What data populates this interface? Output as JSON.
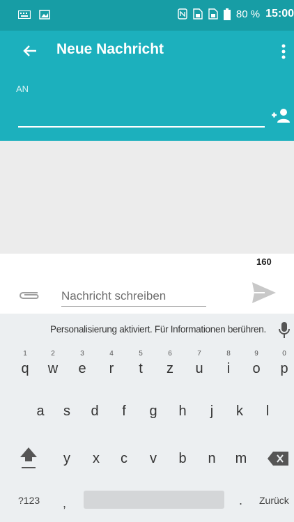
{
  "status": {
    "battery": "80 %",
    "time": "15:00"
  },
  "appbar": {
    "title": "Neue Nachricht"
  },
  "recipient": {
    "label": "AN"
  },
  "compose": {
    "char_count": "160",
    "placeholder": "Nachricht schreiben"
  },
  "keyboard": {
    "suggestion": "Personalisierung aktiviert. Für Informationen berühren.",
    "row1": [
      {
        "key": "q",
        "hint": "1"
      },
      {
        "key": "w",
        "hint": "2"
      },
      {
        "key": "e",
        "hint": "3"
      },
      {
        "key": "r",
        "hint": "4"
      },
      {
        "key": "t",
        "hint": "5"
      },
      {
        "key": "z",
        "hint": "6"
      },
      {
        "key": "u",
        "hint": "7"
      },
      {
        "key": "i",
        "hint": "8"
      },
      {
        "key": "o",
        "hint": "9"
      },
      {
        "key": "p",
        "hint": "0"
      }
    ],
    "row2": [
      "a",
      "s",
      "d",
      "f",
      "g",
      "h",
      "j",
      "k",
      "l"
    ],
    "row3": [
      "y",
      "x",
      "c",
      "v",
      "b",
      "n",
      "m"
    ],
    "numbers_label": "?123",
    "comma": ",",
    "period": ".",
    "enter_label": "Zurück"
  },
  "colors": {
    "appbar": "#1cb0bd",
    "statusbar": "#179da5"
  }
}
